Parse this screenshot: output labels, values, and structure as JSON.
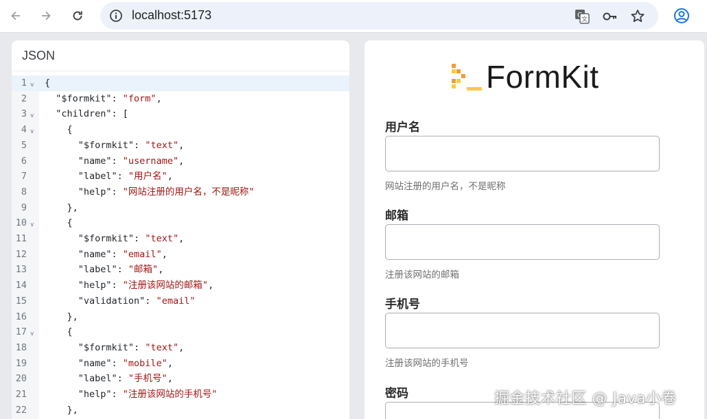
{
  "browser": {
    "url": "localhost:5173",
    "icons": [
      "back-icon",
      "forward-icon",
      "reload-icon",
      "info-icon",
      "translate-icon",
      "key-icon",
      "star-icon",
      "profile-icon"
    ]
  },
  "left_panel": {
    "title": "JSON",
    "lines": [
      {
        "n": "1",
        "fold": "v",
        "parts": [
          [
            "p",
            "{"
          ]
        ]
      },
      {
        "n": "2",
        "fold": "",
        "parts": [
          [
            "p",
            "  \"$formkit\": "
          ],
          [
            "s",
            "\"form\""
          ],
          [
            "p",
            ","
          ]
        ]
      },
      {
        "n": "3",
        "fold": "v",
        "parts": [
          [
            "p",
            "  \"children\": ["
          ]
        ]
      },
      {
        "n": "4",
        "fold": "v",
        "parts": [
          [
            "p",
            "    {"
          ]
        ]
      },
      {
        "n": "5",
        "fold": "",
        "parts": [
          [
            "p",
            "      \"$formkit\": "
          ],
          [
            "s",
            "\"text\""
          ],
          [
            "p",
            ","
          ]
        ]
      },
      {
        "n": "6",
        "fold": "",
        "parts": [
          [
            "p",
            "      \"name\": "
          ],
          [
            "s",
            "\"username\""
          ],
          [
            "p",
            ","
          ]
        ]
      },
      {
        "n": "7",
        "fold": "",
        "parts": [
          [
            "p",
            "      \"label\": "
          ],
          [
            "s",
            "\"用户名\""
          ],
          [
            "p",
            ","
          ]
        ]
      },
      {
        "n": "8",
        "fold": "",
        "parts": [
          [
            "p",
            "      \"help\": "
          ],
          [
            "s",
            "\"网站注册的用户名，不是昵称\""
          ]
        ]
      },
      {
        "n": "9",
        "fold": "",
        "parts": [
          [
            "p",
            "    },"
          ]
        ]
      },
      {
        "n": "10",
        "fold": "v",
        "parts": [
          [
            "p",
            "    {"
          ]
        ]
      },
      {
        "n": "11",
        "fold": "",
        "parts": [
          [
            "p",
            "      \"$formkit\": "
          ],
          [
            "s",
            "\"text\""
          ],
          [
            "p",
            ","
          ]
        ]
      },
      {
        "n": "12",
        "fold": "",
        "parts": [
          [
            "p",
            "      \"name\": "
          ],
          [
            "s",
            "\"email\""
          ],
          [
            "p",
            ","
          ]
        ]
      },
      {
        "n": "13",
        "fold": "",
        "parts": [
          [
            "p",
            "      \"label\": "
          ],
          [
            "s",
            "\"邮箱\""
          ],
          [
            "p",
            ","
          ]
        ]
      },
      {
        "n": "14",
        "fold": "",
        "parts": [
          [
            "p",
            "      \"help\": "
          ],
          [
            "s",
            "\"注册该网站的邮箱\""
          ],
          [
            "p",
            ","
          ]
        ]
      },
      {
        "n": "15",
        "fold": "",
        "parts": [
          [
            "p",
            "      \"validation\": "
          ],
          [
            "s",
            "\"email\""
          ]
        ]
      },
      {
        "n": "16",
        "fold": "",
        "parts": [
          [
            "p",
            "    },"
          ]
        ]
      },
      {
        "n": "17",
        "fold": "v",
        "parts": [
          [
            "p",
            "    {"
          ]
        ]
      },
      {
        "n": "18",
        "fold": "",
        "parts": [
          [
            "p",
            "      \"$formkit\": "
          ],
          [
            "s",
            "\"text\""
          ],
          [
            "p",
            ","
          ]
        ]
      },
      {
        "n": "19",
        "fold": "",
        "parts": [
          [
            "p",
            "      \"name\": "
          ],
          [
            "s",
            "\"mobile\""
          ],
          [
            "p",
            ","
          ]
        ]
      },
      {
        "n": "20",
        "fold": "",
        "parts": [
          [
            "p",
            "      \"label\": "
          ],
          [
            "s",
            "\"手机号\""
          ],
          [
            "p",
            ","
          ]
        ]
      },
      {
        "n": "21",
        "fold": "",
        "parts": [
          [
            "p",
            "      \"help\": "
          ],
          [
            "s",
            "\"注册该网站的手机号\""
          ]
        ]
      },
      {
        "n": "22",
        "fold": "",
        "parts": [
          [
            "p",
            "    },"
          ]
        ]
      }
    ]
  },
  "right_panel": {
    "logo_text": "FormKit",
    "fields": [
      {
        "label": "用户名",
        "help": "网站注册的用户名，不是昵称",
        "value": ""
      },
      {
        "label": "邮箱",
        "help": "注册该网站的邮箱",
        "value": ""
      },
      {
        "label": "手机号",
        "help": "注册该网站的手机号",
        "value": ""
      },
      {
        "label": "密码",
        "help": "",
        "value": ""
      }
    ]
  },
  "watermark": "掘金技术社区 @ Java小卷",
  "colors": {
    "string": "#a31515",
    "logo_orange": "#f39a3a",
    "logo_yellow": "#f7c94b"
  }
}
